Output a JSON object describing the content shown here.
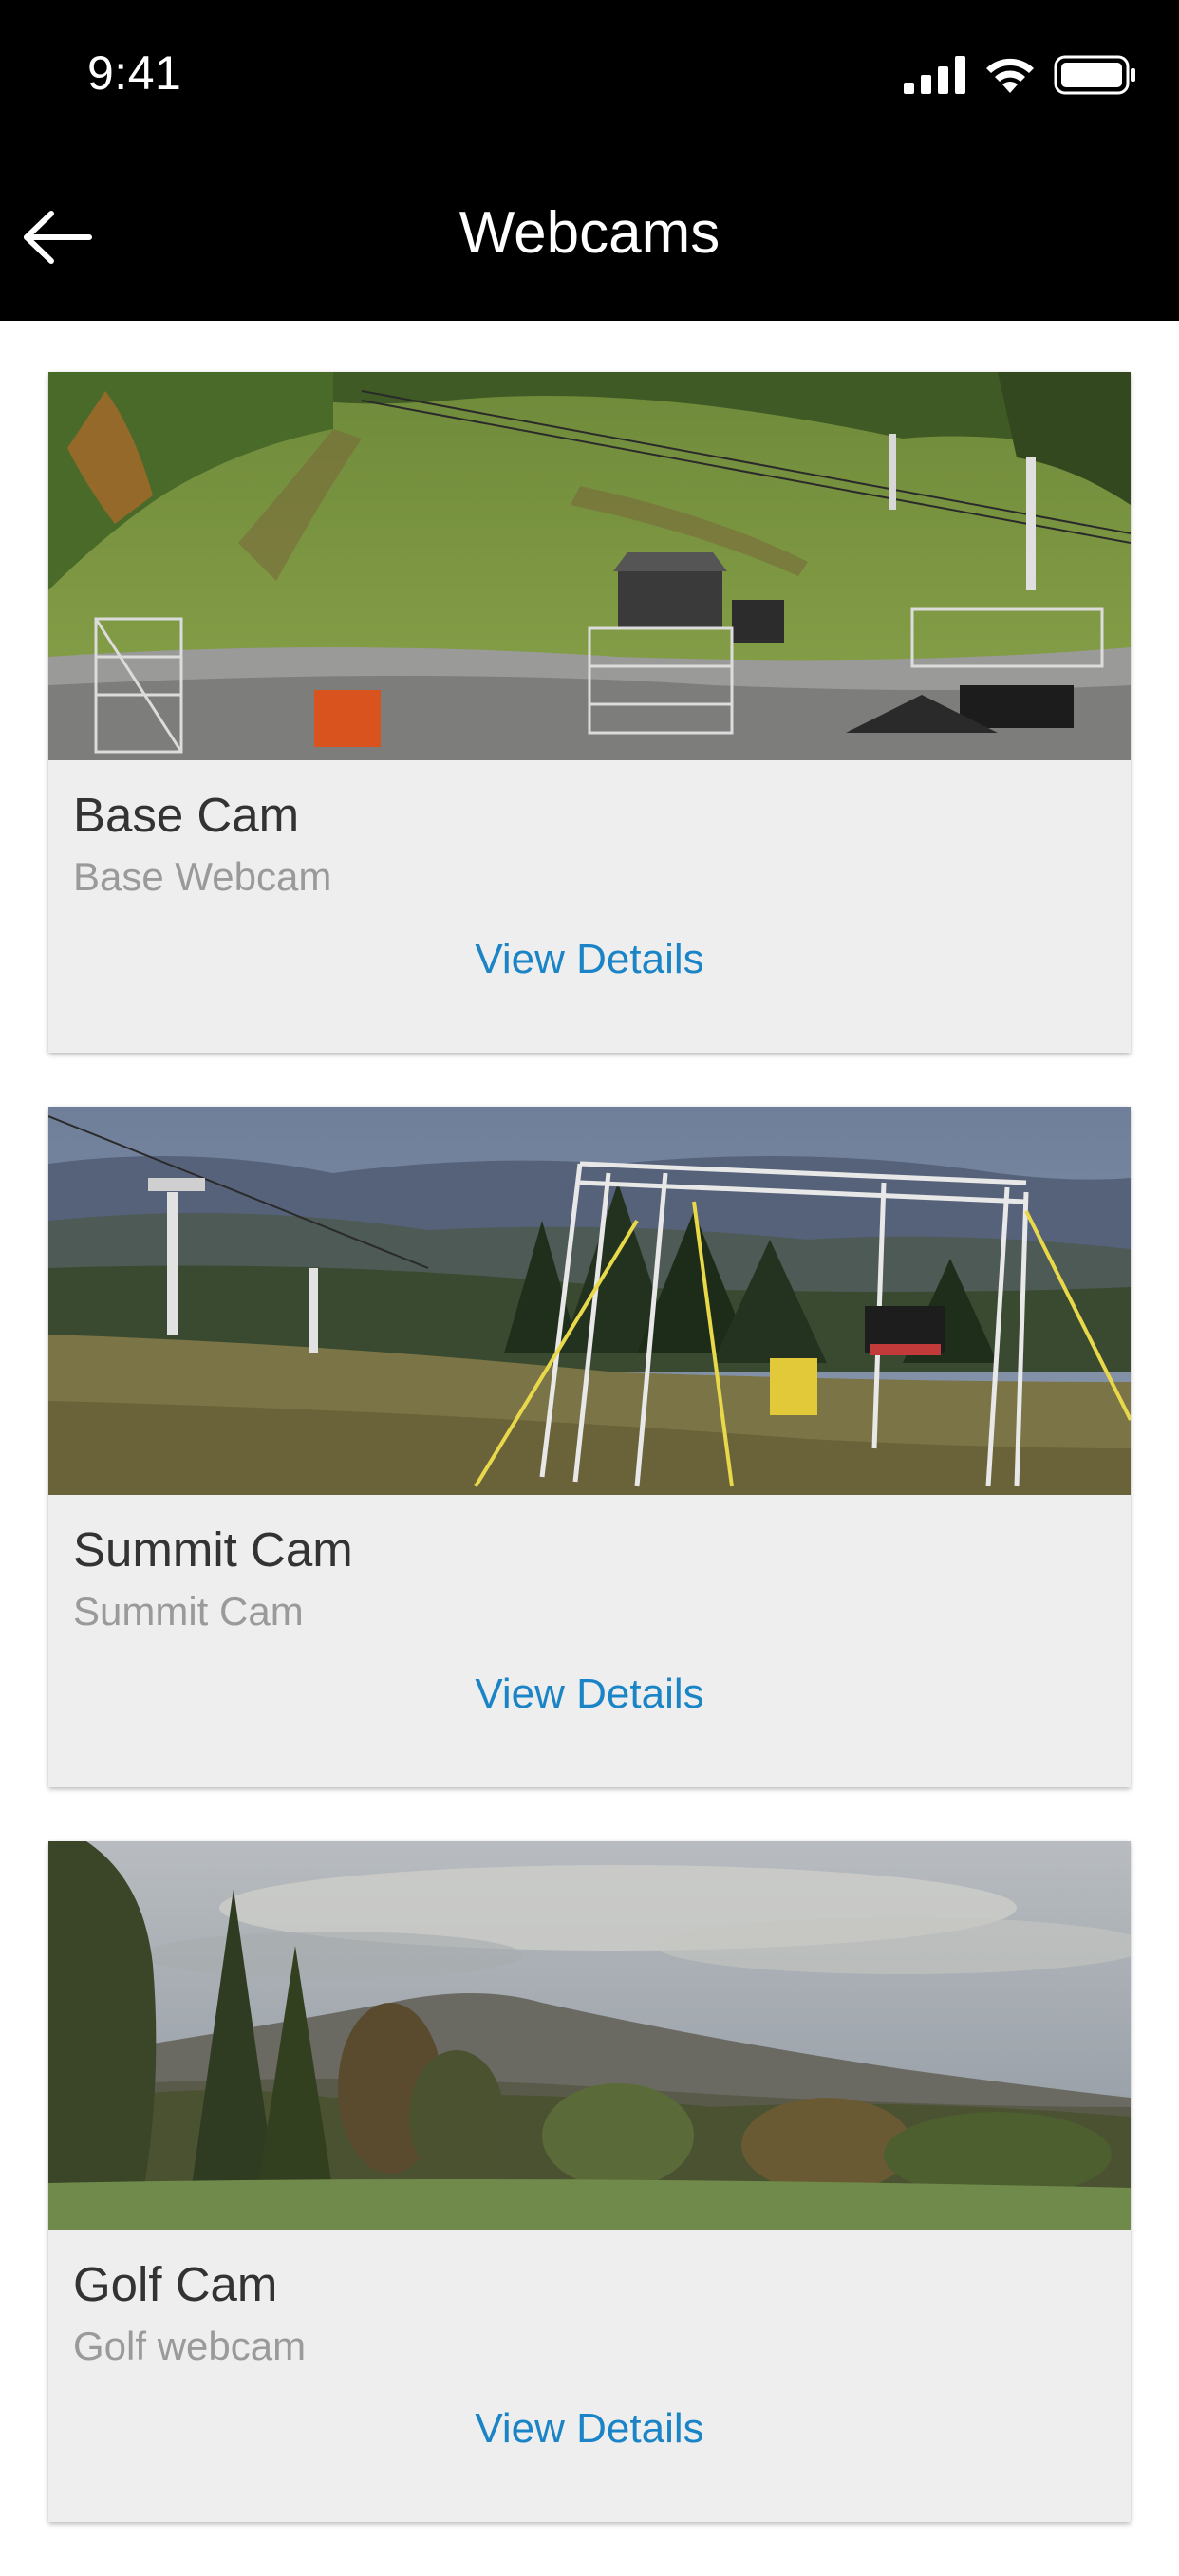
{
  "status_bar": {
    "time": "9:41",
    "icons": [
      "signal-icon",
      "wifi-icon",
      "battery-icon"
    ]
  },
  "header": {
    "title": "Webcams",
    "back_icon": "arrow-left-icon"
  },
  "colors": {
    "bar_background": "#000000",
    "card_background": "#eeeeee",
    "link": "#1b84c6",
    "title_text": "#333333",
    "subtitle_text": "#9a9a9a"
  },
  "webcams": [
    {
      "title": "Base Cam",
      "subtitle": "Base Webcam",
      "action": "View Details",
      "image": "ski base area with lift and scaffolding"
    },
    {
      "title": "Summit Cam",
      "subtitle": "Summit Cam",
      "action": "View Details",
      "image": "mountain summit with truss structure and chairlift"
    },
    {
      "title": "Golf Cam",
      "subtitle": "Golf webcam",
      "action": "View Details",
      "image": "golf course with trees and mountain under clouds"
    }
  ]
}
